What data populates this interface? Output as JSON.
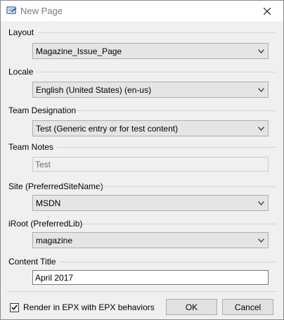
{
  "window": {
    "title": "New Page",
    "close_glyph": "close-icon"
  },
  "fields": {
    "layout": {
      "label": "Layout",
      "value": "Magazine_Issue_Page"
    },
    "locale": {
      "label": "Locale",
      "value": "English (United States) (en-us)"
    },
    "team_designation": {
      "label": "Team Designation",
      "value": "Test (Generic entry or for test content)"
    },
    "team_notes": {
      "label": "Team Notes",
      "value": "Test"
    },
    "site": {
      "label": "Site (PreferredSiteName)",
      "value": "MSDN"
    },
    "iroot": {
      "label": "iRoot (PreferredLib)",
      "value": "magazine"
    },
    "content_title": {
      "label": "Content Title",
      "value": "April 2017"
    }
  },
  "footer": {
    "render_checkbox_label": "Render in EPX with EPX behaviors",
    "render_checked": true,
    "ok_label": "OK",
    "cancel_label": "Cancel"
  },
  "colors": {
    "title_text": "#7b7b7b",
    "dialog_bg": "#f0f0f0",
    "combo_bg": "#e5e5e5",
    "button_bg": "#e1e1e1",
    "icon_blue": "#2b579a"
  }
}
